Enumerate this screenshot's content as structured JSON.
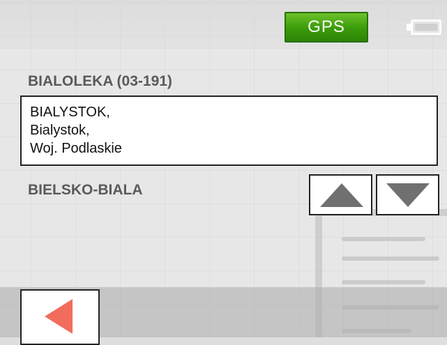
{
  "status_bar": {
    "gps_label": "GPS",
    "battery_icon": "battery-icon"
  },
  "list": {
    "items": [
      {
        "label": "BIALOLEKA (03-191)"
      },
      {
        "lines": [
          "BIALYSTOK,",
          "Bialystok,",
          "Woj. Podlaskie"
        ],
        "selected": true
      },
      {
        "label": "BIELSKO-BIALA"
      }
    ]
  },
  "controls": {
    "scroll_up_icon": "arrow-up-icon",
    "scroll_down_icon": "arrow-down-icon",
    "back_icon": "arrow-left-icon"
  },
  "colors": {
    "gps_badge": "#3a9b0a",
    "back_arrow": "#f26c5e",
    "scroll_arrows": "#707070"
  }
}
